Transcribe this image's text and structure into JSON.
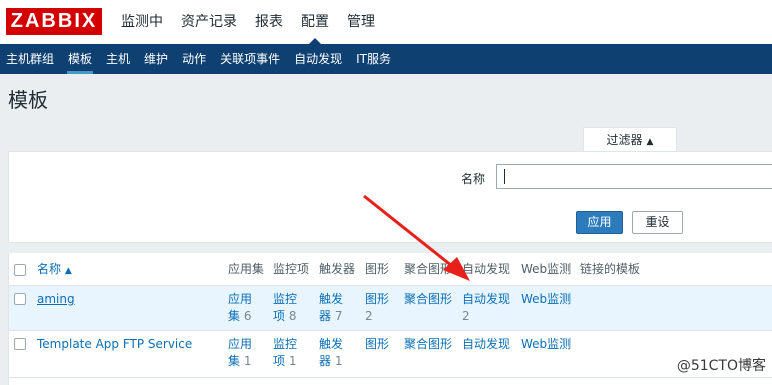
{
  "header": {
    "logo_text": "ZABBIX",
    "nav": [
      "监测中",
      "资产记录",
      "报表",
      "配置",
      "管理"
    ],
    "active_nav": "配置"
  },
  "subnav": {
    "items": [
      "主机群组",
      "模板",
      "主机",
      "维护",
      "动作",
      "关联项事件",
      "自动发现",
      "IT服务"
    ],
    "active": "模板"
  },
  "page": {
    "title": "模板"
  },
  "filter": {
    "tab_label": "过滤器",
    "tab_arrow": "▲",
    "name_label": "名称",
    "name_value": "",
    "apply_label": "应用",
    "reset_label": "重设"
  },
  "table": {
    "columns": {
      "name": "名称",
      "name_sort": "▲",
      "apps": "应用集",
      "items": "监控项",
      "triggers": "触发器",
      "graphs": "图形",
      "screens": "聚合图形",
      "discovery": "自动发现",
      "web": "Web监测",
      "linked": "链接的模板"
    },
    "rows": [
      {
        "name": "aming",
        "apps_label": "应用集",
        "apps_count": "6",
        "items_label": "监控项",
        "items_count": "8",
        "triggers_label": "触发器",
        "triggers_count": "7",
        "graphs_label": "图形",
        "graphs_count": "2",
        "screens_label": "聚合图形",
        "discovery_label": "自动发现",
        "discovery_count": "2",
        "web_label": "Web监测"
      },
      {
        "name": "Template App FTP Service",
        "apps_label": "应用集",
        "apps_count": "1",
        "items_label": "监控项",
        "items_count": "1",
        "triggers_label": "触发器",
        "triggers_count": "1",
        "graphs_label": "图形",
        "graphs_count": "",
        "screens_label": "聚合图形",
        "discovery_label": "自动发现",
        "discovery_count": "",
        "web_label": "Web监测"
      }
    ]
  },
  "annotation": {
    "arrow_color": "#e8201a"
  },
  "watermark": "@51CTO博客"
}
